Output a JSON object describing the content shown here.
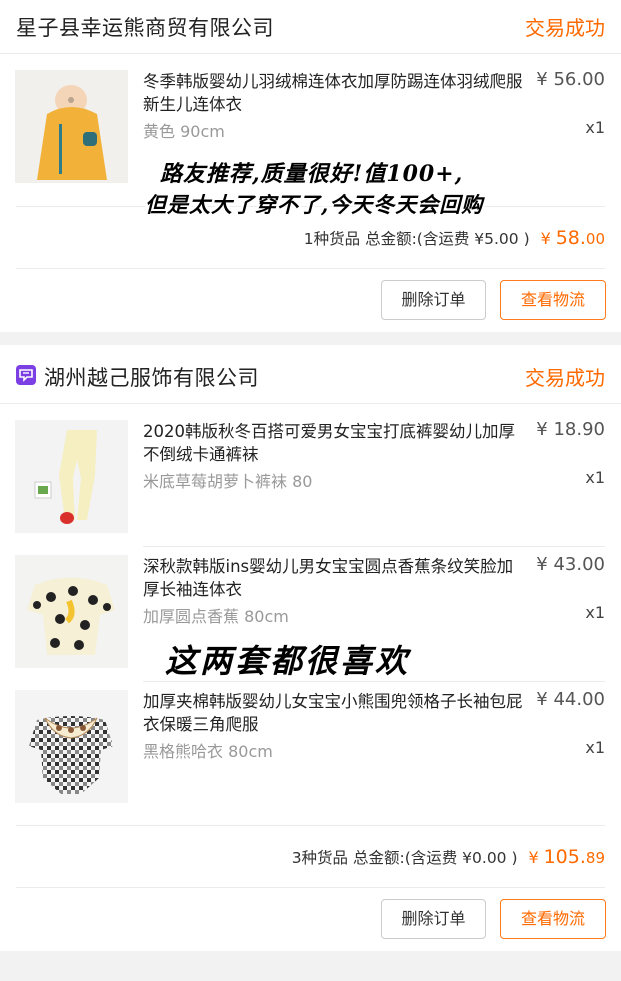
{
  "orders": [
    {
      "shop_name": "星子县幸运熊商贸有限公司",
      "status": "交易成功",
      "items": [
        {
          "title": "冬季韩版婴幼儿羽绒棉连体衣加厚防踢连体羽绒爬服新生儿连体衣",
          "sku": "黄色 90cm",
          "price": "¥ 56.00",
          "qty": "x1"
        }
      ],
      "summary_prefix": "1种货品 总金额:(含运费 ¥5.00 )",
      "currency": "¥",
      "total_int": "58.",
      "total_dec": "00",
      "buttons": {
        "delete": "删除订单",
        "logistics": "查看物流"
      }
    },
    {
      "shop_name": "湖州越己服饰有限公司",
      "status": "交易成功",
      "items": [
        {
          "title": "2020韩版秋冬百搭可爱男女宝宝打底裤婴幼儿加厚不倒绒卡通裤袜",
          "sku": "米底草莓胡萝卜裤袜 80",
          "price": "¥ 18.90",
          "qty": "x1"
        },
        {
          "title": "深秋款韩版ins婴幼儿男女宝宝圆点香蕉条纹笑脸加厚长袖连体衣",
          "sku": "加厚圆点香蕉 80cm",
          "price": "¥ 43.00",
          "qty": "x1"
        },
        {
          "title": "加厚夹棉韩版婴幼儿女宝宝小熊围兜领格子长袖包屁衣保暖三角爬服",
          "sku": "黑格熊哈衣 80cm",
          "price": "¥ 44.00",
          "qty": "x1"
        }
      ],
      "summary_prefix": "3种货品 总金额:(含运费 ¥0.00 )",
      "currency": "¥",
      "total_int": "105.",
      "total_dec": "89",
      "buttons": {
        "delete": "删除订单",
        "logistics": "查看物流"
      }
    }
  ],
  "overlays": {
    "review1_line1": "路友推荐,质量很好!值100+,",
    "review1_line2": "但是太大了穿不了,今天冬天会回购",
    "review2": "这两套都很喜欢"
  },
  "colors": {
    "accent": "#ff6a00",
    "shop_icon": "#7b3fe4"
  },
  "icons": {
    "shop2": "shop-badge-icon"
  }
}
